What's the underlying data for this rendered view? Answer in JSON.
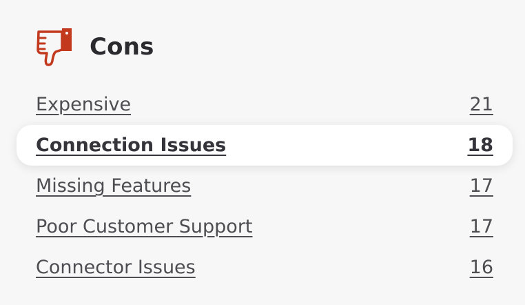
{
  "section": {
    "title": "Cons",
    "icon": "thumbs-down-icon",
    "accent_color": "#c2391e"
  },
  "cons": [
    {
      "label": "Expensive",
      "count": "21",
      "active": false
    },
    {
      "label": "Connection Issues",
      "count": "18",
      "active": true
    },
    {
      "label": "Missing Features",
      "count": "17",
      "active": false
    },
    {
      "label": "Poor Customer Support",
      "count": "17",
      "active": false
    },
    {
      "label": "Connector Issues",
      "count": "16",
      "active": false
    }
  ]
}
